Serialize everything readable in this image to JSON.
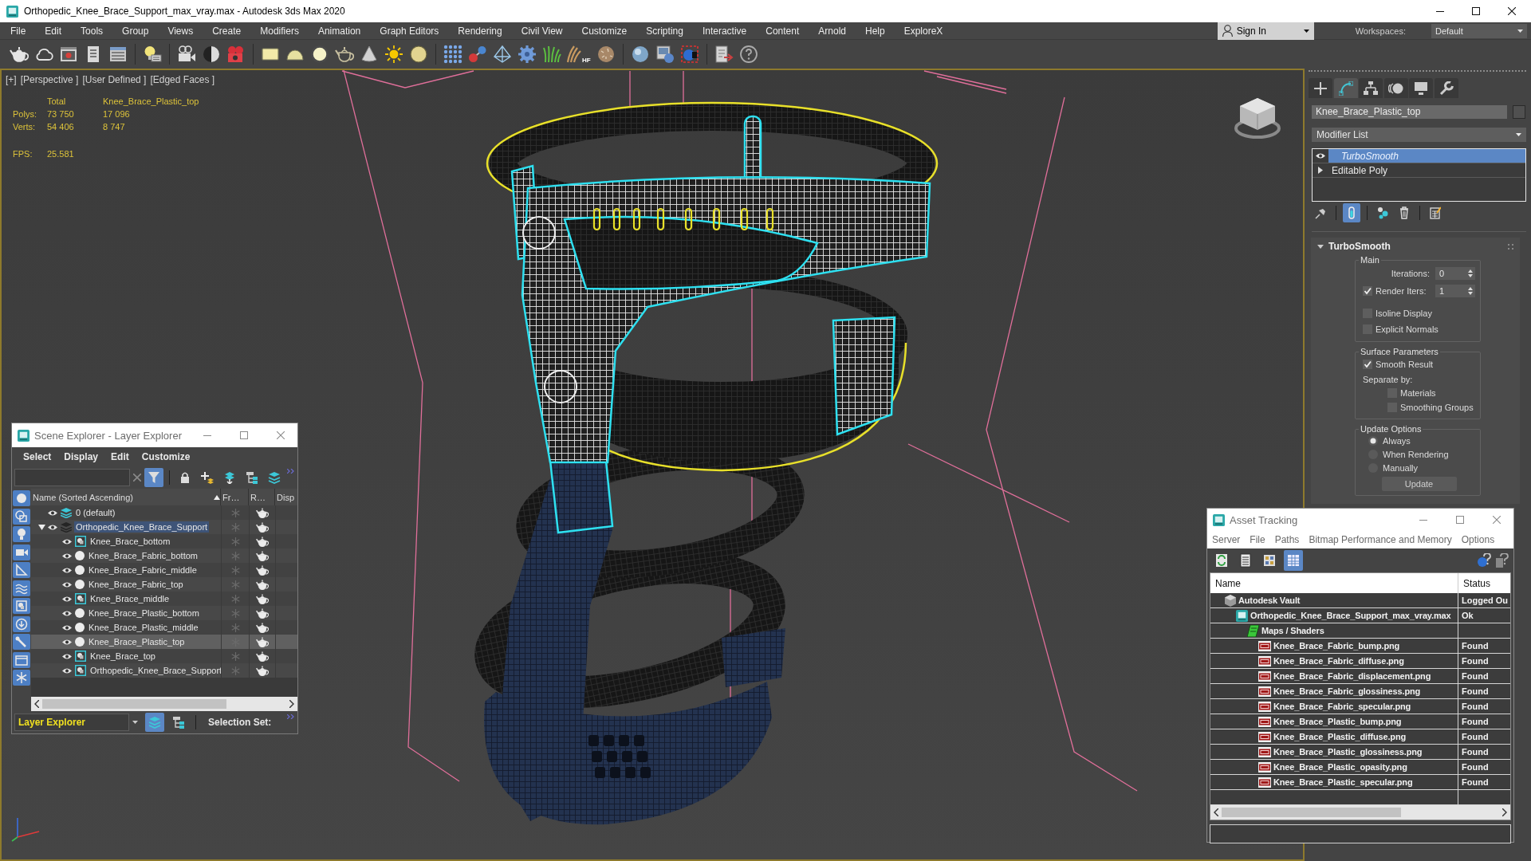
{
  "window": {
    "title": "Orthopedic_Knee_Brace_Support_max_vray.max - Autodesk 3ds Max 2020"
  },
  "menu_bar": {
    "items": [
      "File",
      "Edit",
      "Tools",
      "Group",
      "Views",
      "Create",
      "Modifiers",
      "Animation",
      "Graph Editors",
      "Rendering",
      "Civil View",
      "Customize",
      "Scripting",
      "Interactive",
      "Content",
      "Arnold",
      "Help",
      "ExploreX"
    ],
    "sign_in": "Sign In",
    "workspaces_label": "Workspaces:",
    "workspace": "Default"
  },
  "toolbar": {
    "hair_caption": "HF"
  },
  "viewport": {
    "labels": [
      "[+]",
      "[Perspective ]",
      "[User Defined ]",
      "[Edged Faces ]"
    ],
    "stats": {
      "columns": [
        "Total",
        "Knee_Brace_Plastic_top"
      ],
      "rows": [
        {
          "label": "Polys:",
          "values": [
            "73 750",
            "17 096"
          ]
        },
        {
          "label": "Verts:",
          "values": [
            "54 406",
            "8 747"
          ]
        }
      ],
      "fps_label": "FPS:",
      "fps": "25.581"
    }
  },
  "scene_explorer": {
    "title": "Scene Explorer - Layer Explorer",
    "menu": [
      "Select",
      "Display",
      "Edit",
      "Customize"
    ],
    "tools": [
      {
        "kind": "filter",
        "on": true
      },
      {
        "kind": "lock",
        "on": false
      },
      {
        "kind": "new-layer",
        "on": false
      },
      {
        "kind": "add-to-layer",
        "on": false
      },
      {
        "kind": "hierarchy",
        "on": false
      },
      {
        "kind": "layers",
        "on": false
      }
    ],
    "filters": [
      {
        "kind": "geometry",
        "on": true
      },
      {
        "kind": "shapes",
        "on": true
      },
      {
        "kind": "lights",
        "on": true
      },
      {
        "kind": "cameras",
        "on": true
      },
      {
        "kind": "helpers",
        "on": true
      },
      {
        "kind": "spacewarps",
        "on": true
      },
      {
        "kind": "groups",
        "on": true
      },
      {
        "kind": "xrefs",
        "on": true
      },
      {
        "kind": "bones",
        "on": true
      },
      {
        "kind": "containers",
        "on": true
      },
      {
        "kind": "frozen",
        "on": true
      }
    ],
    "columns": [
      "Name (Sorted Ascending)",
      "Fr…",
      "R…",
      "Disp"
    ],
    "rows": [
      {
        "name": "0 (default)",
        "kind": "layer",
        "selected": false,
        "current": true,
        "visible": true,
        "frozen": false,
        "renderable": true
      },
      {
        "name": "Orthopedic_Knee_Brace_Support",
        "kind": "layer",
        "selected": true,
        "current": false,
        "expanded": true,
        "visible": true,
        "frozen": false,
        "renderable": true,
        "children": [
          {
            "name": "Knee_Brace_bottom",
            "kind": "group",
            "selected": false,
            "visible": true,
            "frozen": false,
            "renderable": true
          },
          {
            "name": "Knee_Brace_Fabric_bottom",
            "kind": "geometry",
            "selected": false,
            "visible": true,
            "frozen": false,
            "renderable": true
          },
          {
            "name": "Knee_Brace_Fabric_middle",
            "kind": "geometry",
            "selected": false,
            "visible": true,
            "frozen": false,
            "renderable": true
          },
          {
            "name": "Knee_Brace_Fabric_top",
            "kind": "geometry",
            "selected": false,
            "visible": true,
            "frozen": false,
            "renderable": true
          },
          {
            "name": "Knee_Brace_middle",
            "kind": "group",
            "selected": false,
            "visible": true,
            "frozen": false,
            "renderable": true
          },
          {
            "name": "Knee_Brace_Plastic_bottom",
            "kind": "geometry",
            "selected": false,
            "visible": true,
            "frozen": false,
            "renderable": true
          },
          {
            "name": "Knee_Brace_Plastic_middle",
            "kind": "geometry",
            "selected": false,
            "visible": true,
            "frozen": false,
            "renderable": true
          },
          {
            "name": "Knee_Brace_Plastic_top",
            "kind": "geometry",
            "selected": true,
            "visible": true,
            "frozen": false,
            "renderable": true
          },
          {
            "name": "Knee_Brace_top",
            "kind": "group",
            "selected": false,
            "visible": true,
            "frozen": false,
            "renderable": true
          },
          {
            "name": "Orthopedic_Knee_Brace_Support",
            "kind": "group",
            "selected": false,
            "visible": true,
            "frozen": false,
            "renderable": true
          }
        ]
      }
    ],
    "explorer": "Layer Explorer",
    "views": [
      {
        "kind": "layers",
        "selected": true
      },
      {
        "kind": "hierarchy",
        "selected": false
      }
    ],
    "selection_set_label": "Selection Set:"
  },
  "command_panel": {
    "tabs": [
      {
        "kind": "create",
        "selected": false
      },
      {
        "kind": "modify",
        "selected": true
      },
      {
        "kind": "hierarchy",
        "selected": false
      },
      {
        "kind": "motion",
        "selected": false
      },
      {
        "kind": "display",
        "selected": false
      },
      {
        "kind": "utilities",
        "selected": false
      }
    ],
    "object_name": "Knee_Brace_Plastic_top",
    "modifier_list": "Modifier List",
    "stack": [
      {
        "label": "TurboSmooth",
        "kind": "modifier",
        "selected": true
      },
      {
        "label": "Editable Poly",
        "kind": "base",
        "selected": false
      }
    ],
    "stack_tools": [
      {
        "kind": "pin",
        "on": false
      },
      {
        "kind": "show-end-result",
        "on": true
      },
      {
        "kind": "make-unique",
        "on": false
      },
      {
        "kind": "remove",
        "on": false
      },
      {
        "kind": "configure",
        "on": false
      }
    ],
    "rollout": {
      "title": "TurboSmooth",
      "groups": [
        {
          "title": "Main",
          "controls": [
            {
              "kind": "spinner",
              "label": "Iterations:",
              "value": "0"
            },
            {
              "kind": "check-spinner",
              "label": "Render Iters:",
              "checked": true,
              "value": "1"
            },
            {
              "kind": "checkbox",
              "label": "Isoline Display",
              "checked": false
            },
            {
              "kind": "checkbox",
              "label": "Explicit Normals",
              "checked": false
            }
          ]
        },
        {
          "title": "Surface Parameters",
          "controls": [
            {
              "kind": "checkbox",
              "label": "Smooth Result",
              "checked": true
            },
            {
              "kind": "label",
              "label": "Separate by:"
            },
            {
              "kind": "sub-checkbox",
              "label": "Materials",
              "checked": false
            },
            {
              "kind": "sub-checkbox",
              "label": "Smoothing Groups",
              "checked": false
            }
          ]
        },
        {
          "title": "Update Options",
          "controls": [
            {
              "kind": "radio",
              "label": "Always",
              "selected": true
            },
            {
              "kind": "radio",
              "label": "When Rendering",
              "selected": false
            },
            {
              "kind": "radio",
              "label": "Manually",
              "selected": false
            },
            {
              "kind": "button",
              "label": "Update"
            }
          ]
        }
      ]
    }
  },
  "asset_tracking": {
    "title": "Asset Tracking",
    "menu": [
      "Server",
      "File",
      "Paths",
      "Bitmap Performance and Memory",
      "Options"
    ],
    "tools": [
      {
        "kind": "refresh",
        "on": false
      },
      {
        "kind": "list",
        "on": false
      },
      {
        "kind": "thumbnails",
        "on": false
      },
      {
        "kind": "table",
        "on": true
      }
    ],
    "columns": [
      "Name",
      "Status"
    ],
    "rows": [
      {
        "name": "Autodesk Vault",
        "kind": "vault",
        "status": "Logged Ou",
        "children": [
          {
            "name": "Orthopedic_Knee_Brace_Support_max_vray.max",
            "kind": "scene",
            "status": "Ok",
            "children": [
              {
                "name": "Maps / Shaders",
                "kind": "folder",
                "children": [
                  {
                    "name": "Knee_Brace_Fabric_bump.png",
                    "kind": "image",
                    "status": "Found"
                  },
                  {
                    "name": "Knee_Brace_Fabric_diffuse.png",
                    "kind": "image",
                    "status": "Found"
                  },
                  {
                    "name": "Knee_Brace_Fabric_displacement.png",
                    "kind": "image",
                    "status": "Found"
                  },
                  {
                    "name": "Knee_Brace_Fabric_glossiness.png",
                    "kind": "image",
                    "status": "Found"
                  },
                  {
                    "name": "Knee_Brace_Fabric_specular.png",
                    "kind": "image",
                    "status": "Found"
                  },
                  {
                    "name": "Knee_Brace_Plastic_bump.png",
                    "kind": "image",
                    "status": "Found"
                  },
                  {
                    "name": "Knee_Brace_Plastic_diffuse.png",
                    "kind": "image",
                    "status": "Found"
                  },
                  {
                    "name": "Knee_Brace_Plastic_glossiness.png",
                    "kind": "image",
                    "status": "Found"
                  },
                  {
                    "name": "Knee_Brace_Plastic_opasity.png",
                    "kind": "image",
                    "status": "Found"
                  },
                  {
                    "name": "Knee_Brace_Plastic_specular.png",
                    "kind": "image",
                    "status": "Found"
                  }
                ]
              }
            ]
          }
        ]
      }
    ]
  }
}
